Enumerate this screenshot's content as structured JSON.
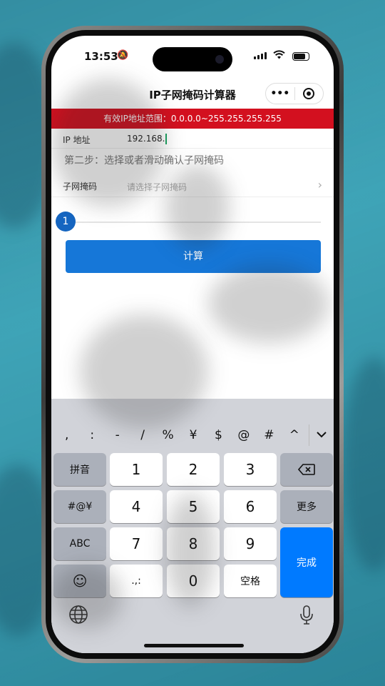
{
  "status": {
    "time": "13:53"
  },
  "nav": {
    "title": "IP子网掩码计算器",
    "more": "•••"
  },
  "banner": "有效IP地址范围：0.0.0.0~255.255.255.255",
  "ip": {
    "label": "IP 地址",
    "value": "192.168."
  },
  "step2": "第二步：选择或者滑动确认子网掩码",
  "mask": {
    "label": "子网掩码",
    "placeholder": "请选择子网掩码",
    "chevron": "›"
  },
  "slider": {
    "value": "1"
  },
  "calc_button": "计算",
  "keyboard": {
    "symbols": [
      ",",
      ":",
      "-",
      "/",
      "%",
      "¥",
      "$",
      "@",
      "#",
      "^"
    ],
    "collapse": "⌄",
    "pinyin": "拼音",
    "symbols_key": "#@¥",
    "abc": "ABC",
    "emoji": "☺",
    "digits": [
      "1",
      "2",
      "3",
      "4",
      "5",
      "6",
      "7",
      "8",
      "9"
    ],
    "zero": "0",
    "punct": ".,:",
    "space": "空格",
    "more": "更多",
    "done": "完成",
    "backspace": "⌫"
  }
}
